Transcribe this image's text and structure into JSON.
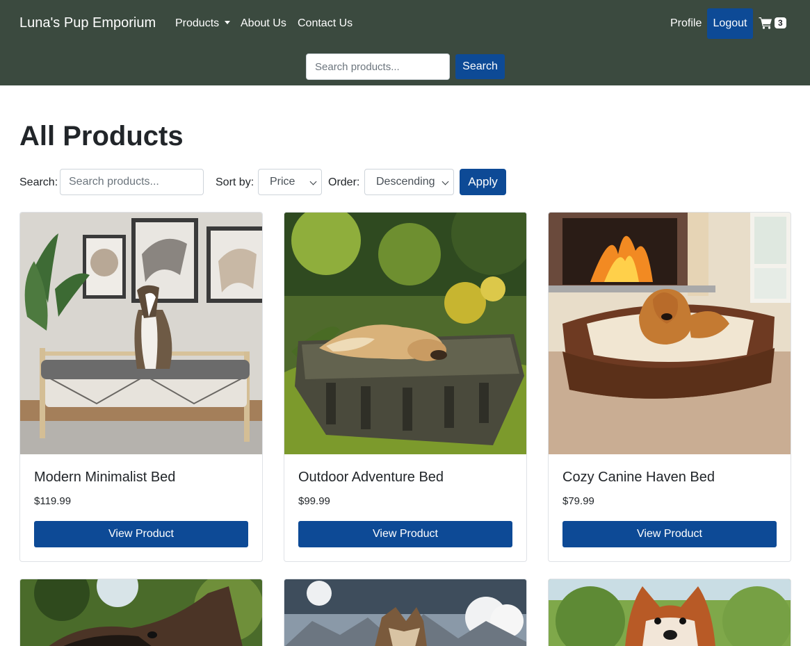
{
  "navbar": {
    "brand": "Luna's Pup Emporium",
    "products_label": "Products",
    "about_label": "About Us",
    "contact_label": "Contact Us",
    "profile_label": "Profile",
    "logout_label": "Logout",
    "cart_count": "3",
    "search_placeholder": "Search products...",
    "search_button": "Search",
    "background_color": "#3b4a3f",
    "accent_color": "#0d4a96"
  },
  "main": {
    "title": "All Products",
    "filters": {
      "search_label": "Search:",
      "search_placeholder": "Search products...",
      "sort_label": "Sort by:",
      "sort_value": "Price",
      "order_label": "Order:",
      "order_value": "Descending",
      "apply_label": "Apply"
    },
    "products": [
      {
        "name": "Modern Minimalist Bed",
        "price": "$119.99",
        "button": "View Product"
      },
      {
        "name": "Outdoor Adventure Bed",
        "price": "$99.99",
        "button": "View Product"
      },
      {
        "name": "Cozy Canine Haven Bed",
        "price": "$79.99",
        "button": "View Product"
      }
    ]
  }
}
